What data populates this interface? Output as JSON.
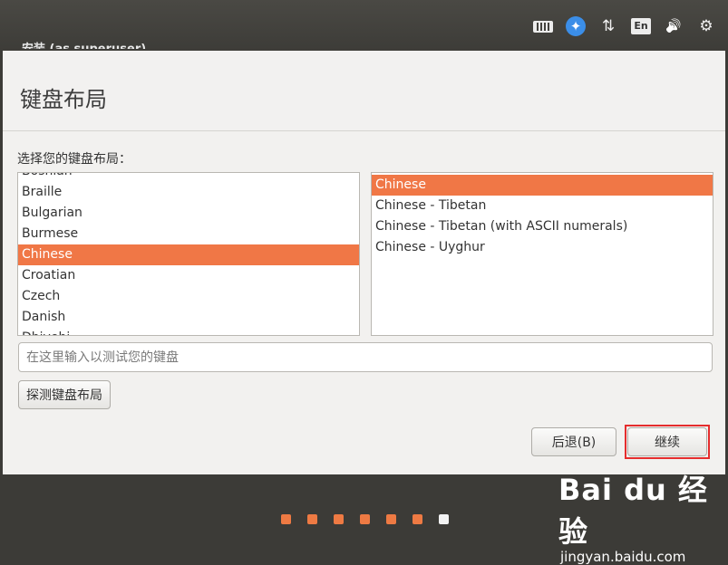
{
  "window": {
    "title": "安装 (as superuser)"
  },
  "top_panel": {
    "indicators": {
      "keyboard_icon": "keyboard-icon",
      "a11y_glyph": "✦",
      "network_glyph": "⇅",
      "language_label": "En",
      "volume_glyph": "🔊",
      "power_glyph": "⚙"
    }
  },
  "page": {
    "title": "键盘布局"
  },
  "layout_selector": {
    "label": "选择您的键盘布局：",
    "layouts": [
      "Bosnian",
      "Braille",
      "Bulgarian",
      "Burmese",
      "Chinese",
      "Croatian",
      "Czech",
      "Danish",
      "Dhivehi"
    ],
    "selected_layout": "Chinese",
    "variants": [
      "Chinese",
      "Chinese - Tibetan",
      "Chinese - Tibetan (with ASCII numerals)",
      "Chinese - Uyghur"
    ],
    "selected_variant": "Chinese"
  },
  "test_field": {
    "placeholder": "在这里输入以测试您的键盘",
    "value": ""
  },
  "buttons": {
    "detect": "探测键盘布局",
    "back": "后退(B)",
    "continue": "继续"
  },
  "progress": {
    "total_steps": 7,
    "current_step": 7
  },
  "watermark": {
    "logo": "Bai du 经验",
    "url": "jingyan.baidu.com"
  },
  "colors": {
    "accent": "#f07746",
    "highlight": "#e52d2d",
    "panel": "#3c3b37"
  }
}
